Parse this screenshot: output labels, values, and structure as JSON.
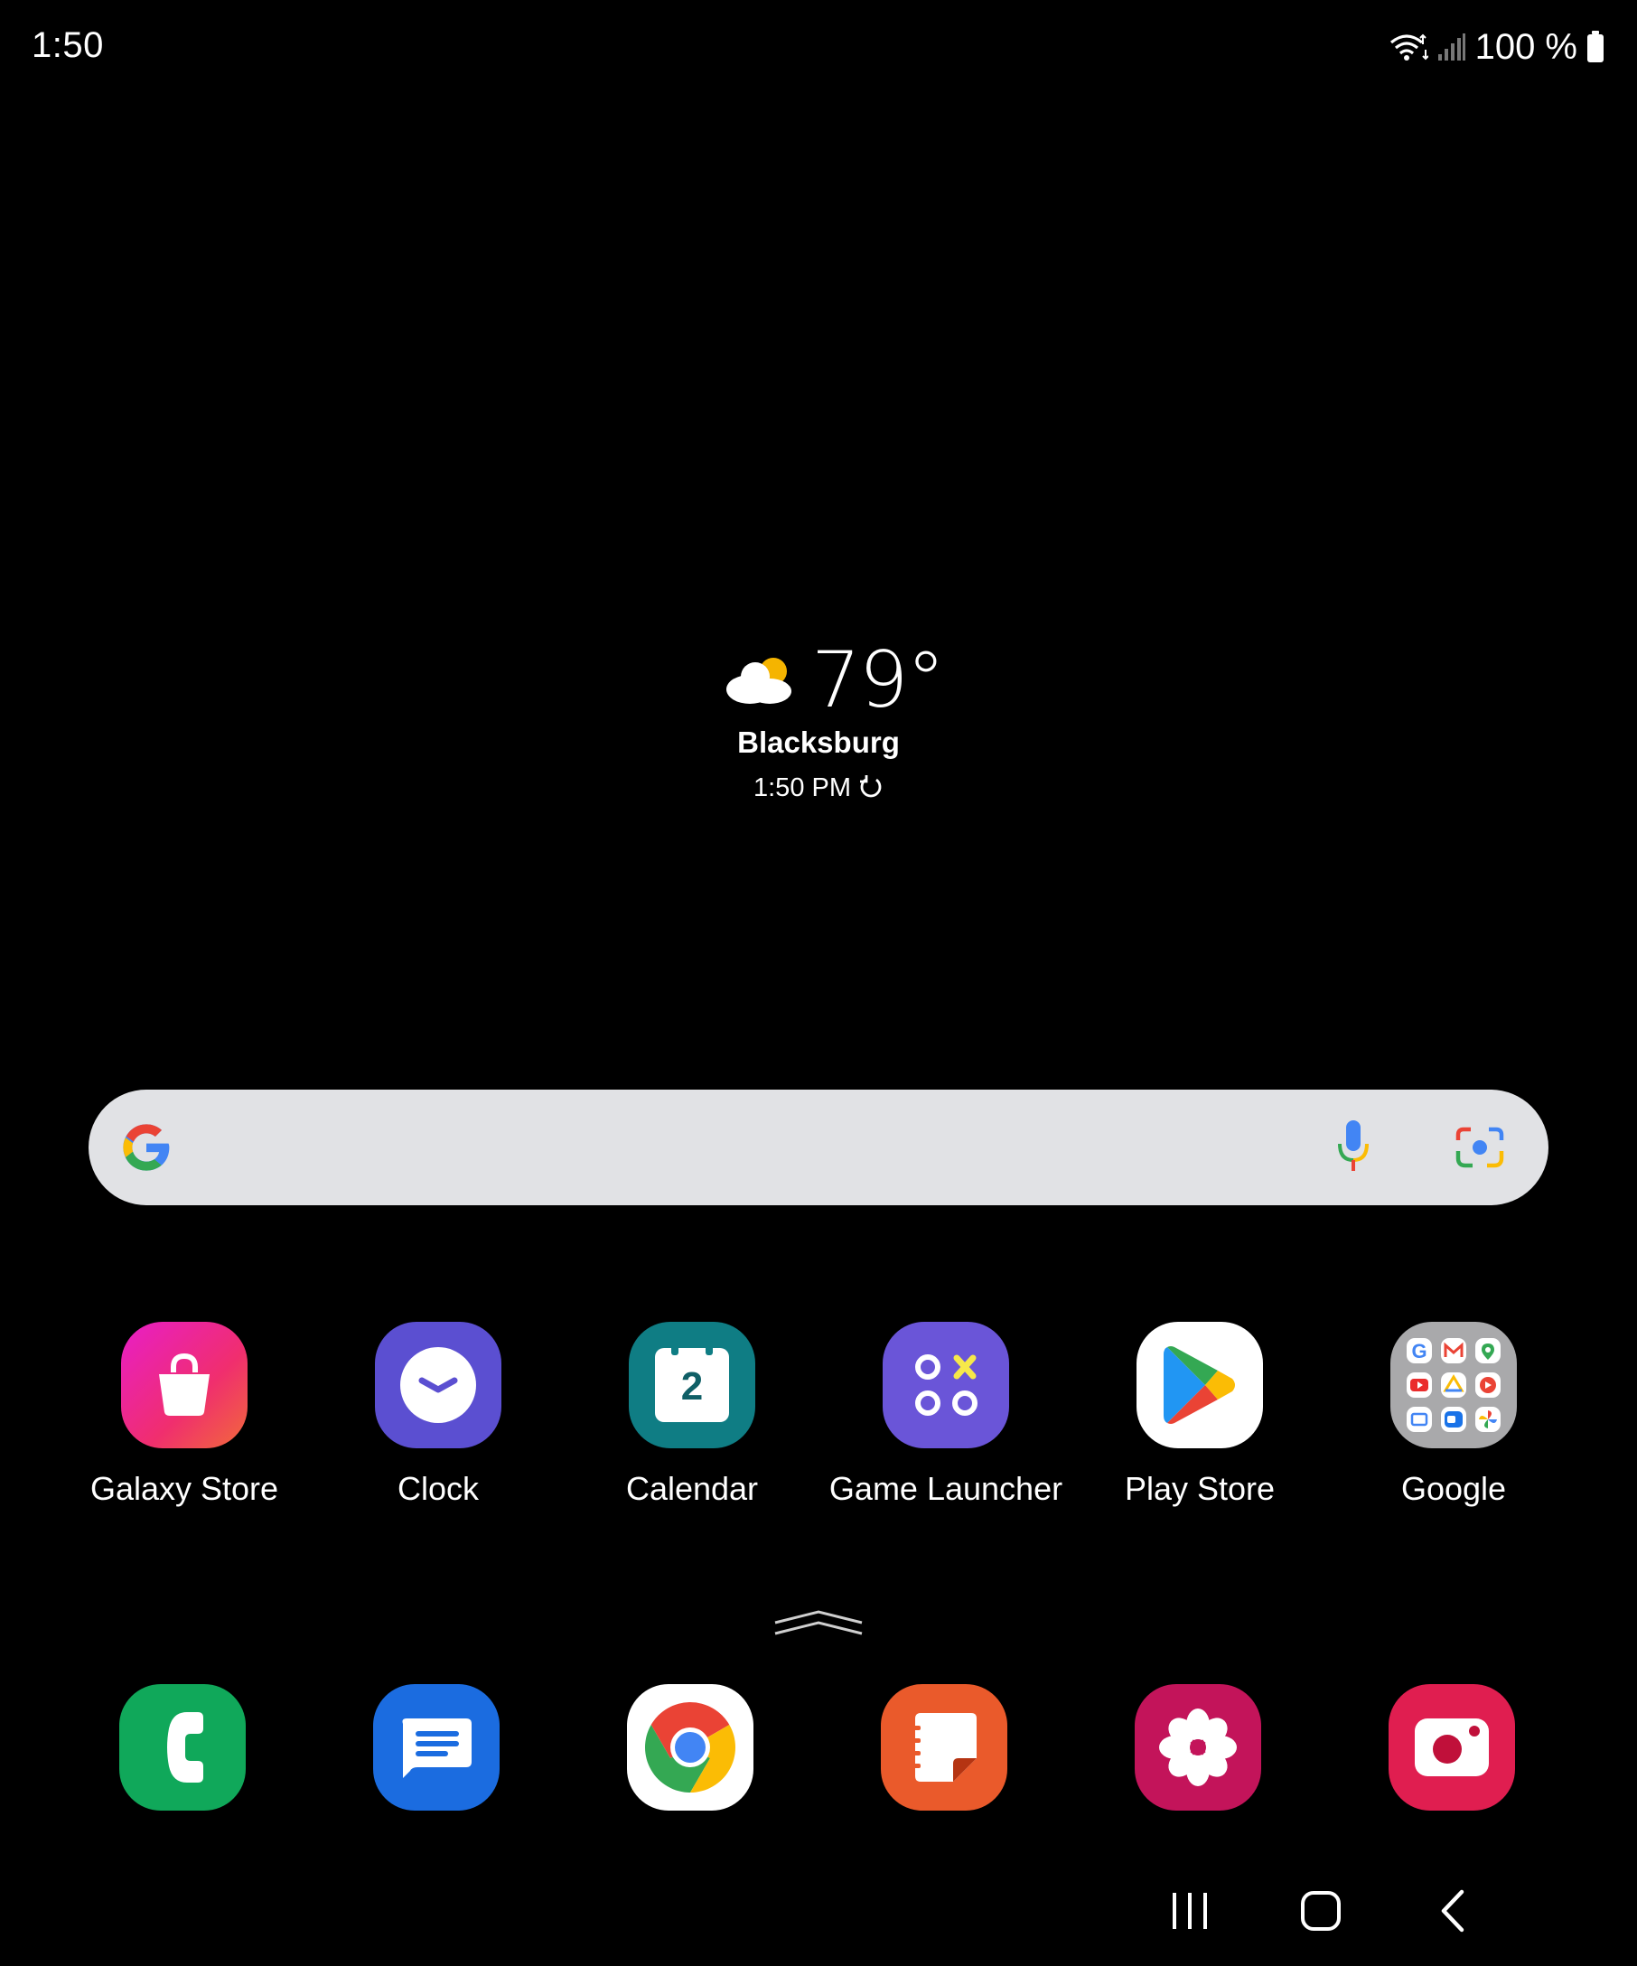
{
  "status_bar": {
    "time": "1:50",
    "battery_percent": "100 %",
    "icons": [
      "wifi-icon",
      "signal-icon",
      "battery-icon"
    ]
  },
  "weather": {
    "temperature": "79°",
    "city": "Blacksburg",
    "updated_time": "1:50 PM",
    "condition_icon": "partly-cloudy-icon"
  },
  "search_bar": {
    "icons": [
      "google-logo-icon",
      "microphone-icon",
      "google-lens-icon"
    ]
  },
  "apps": [
    {
      "label": "Galaxy Store",
      "icon": "galaxy-store-icon",
      "color": "#e8207c"
    },
    {
      "label": "Clock",
      "icon": "clock-icon",
      "color": "#5b4fd1"
    },
    {
      "label": "Calendar",
      "icon": "calendar-icon",
      "color": "#0f7d84",
      "day": "2"
    },
    {
      "label": "Game Launcher",
      "icon": "game-launcher-icon",
      "color": "#6a55d8"
    },
    {
      "label": "Play Store",
      "icon": "play-store-icon",
      "color": "#ffffff"
    },
    {
      "label": "Google",
      "icon": "google-folder-icon",
      "color": "#a9a9ab"
    }
  ],
  "dock": [
    {
      "icon": "phone-icon",
      "color": "#10a85a"
    },
    {
      "icon": "messages-icon",
      "color": "#1b6ce0"
    },
    {
      "icon": "chrome-icon",
      "color": "#ffffff"
    },
    {
      "icon": "notes-icon",
      "color": "#ea5a2b"
    },
    {
      "icon": "gallery-icon",
      "color": "#c3145a"
    },
    {
      "icon": "camera-icon",
      "color": "#e01e50"
    }
  ],
  "nav_bar": {
    "buttons": [
      "recents-button",
      "home-button",
      "back-button"
    ]
  }
}
